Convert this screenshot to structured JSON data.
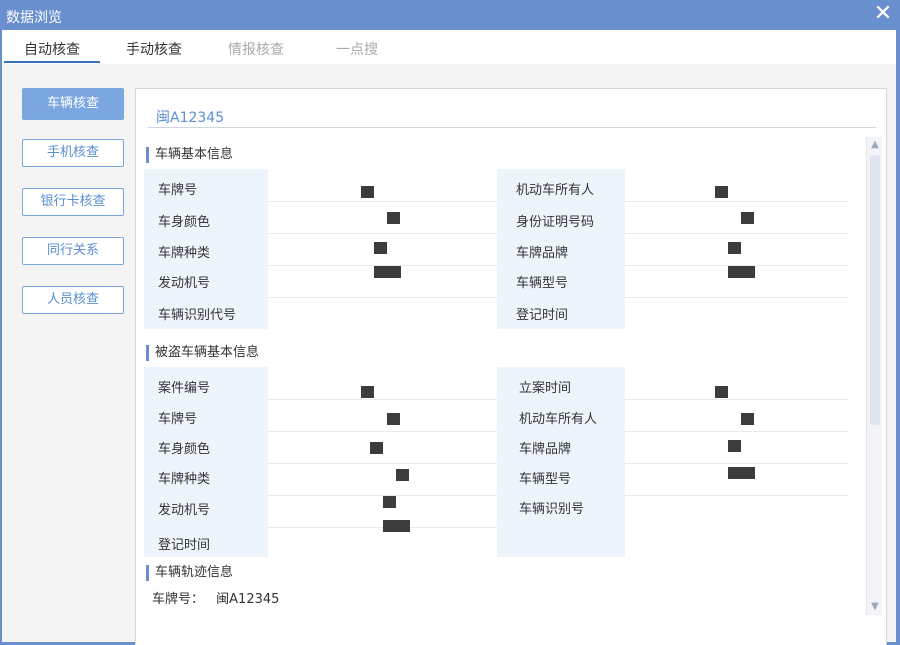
{
  "window": {
    "title": "数据浏览",
    "close_glyph": "✕"
  },
  "tabs": [
    {
      "label": "自动核查",
      "state": "active"
    },
    {
      "label": "手动核查",
      "state": "normal"
    },
    {
      "label": "情报核查",
      "state": "disabled"
    },
    {
      "label": "一点搜",
      "state": "disabled"
    }
  ],
  "sidebar": {
    "items": [
      {
        "label": "车辆核查",
        "active": true
      },
      {
        "label": "手机核查",
        "active": false
      },
      {
        "label": "银行卡核查",
        "active": false
      },
      {
        "label": "同行关系",
        "active": false
      },
      {
        "label": "人员核查",
        "active": false
      }
    ]
  },
  "main": {
    "plate_heading": "闽A12345",
    "sections": {
      "vehicle_basic": {
        "title": "车辆基本信息",
        "left_labels": [
          "车牌号",
          "车身颜色",
          "车牌种类",
          "发动机号",
          "车辆识别代号"
        ],
        "right_labels": [
          "机动车所有人",
          "身份证明号码",
          "车牌品牌",
          "车辆型号",
          "登记时间"
        ]
      },
      "stolen_vehicle": {
        "title": "被盗车辆基本信息",
        "left_labels": [
          "案件编号",
          "车牌号",
          "车身颜色",
          "车牌种类",
          "发动机号",
          "登记时间"
        ],
        "right_labels": [
          "立案时间",
          "机动车所有人",
          "车牌品牌",
          "车辆型号",
          "车辆识别号"
        ]
      },
      "track": {
        "title": "车辆轨迹信息",
        "plate_label": "车牌号：",
        "plate_value": "闽A12345"
      }
    }
  },
  "icons": {
    "close": "close-icon",
    "scroll_up": "chevron-up-icon",
    "scroll_down": "chevron-down-icon"
  },
  "colors": {
    "titlebar": "#6a8fcf",
    "accent": "#5a8fd0",
    "sidebar_active": "#7aa7e0",
    "label_bg": "#eef4fc",
    "redaction": "#3c3c3c"
  }
}
